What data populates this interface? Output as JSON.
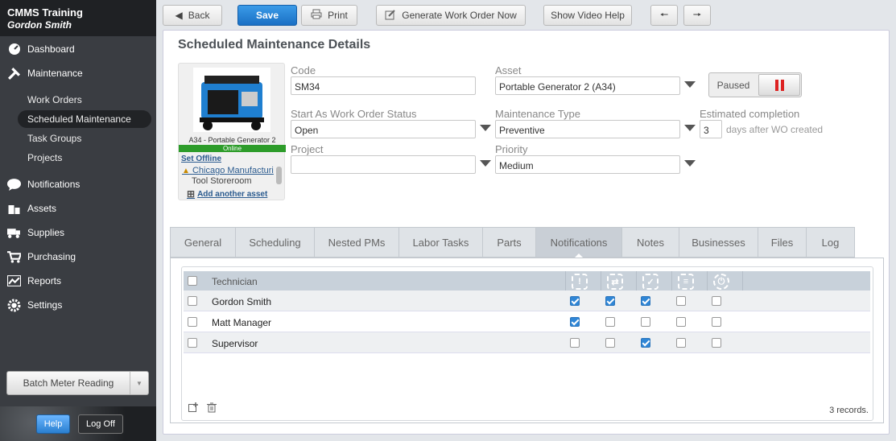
{
  "app": {
    "name": "CMMS Training",
    "user": "Gordon Smith"
  },
  "sidebar": {
    "items": [
      {
        "label": "Dashboard",
        "icon": "dashboard-icon"
      },
      {
        "label": "Maintenance",
        "icon": "tools-icon"
      },
      {
        "label": "Notifications",
        "icon": "chat-bubble-icon"
      },
      {
        "label": "Assets",
        "icon": "boxes-icon"
      },
      {
        "label": "Supplies",
        "icon": "truck-icon"
      },
      {
        "label": "Purchasing",
        "icon": "cart-icon"
      },
      {
        "label": "Reports",
        "icon": "chart-icon"
      },
      {
        "label": "Settings",
        "icon": "gear-icon"
      }
    ],
    "subitems": [
      "Work Orders",
      "Scheduled Maintenance",
      "Task Groups",
      "Projects"
    ],
    "batch_label": "Batch Meter Reading",
    "help": "Help",
    "logoff": "Log Off"
  },
  "toolbar": {
    "back": "Back",
    "save": "Save",
    "print": "Print",
    "generate": "Generate Work Order Now",
    "video": "Show Video Help"
  },
  "page": {
    "title": "Scheduled Maintenance Details"
  },
  "asset_card": {
    "caption": "A34 - Portable Generator 2",
    "status": "Online",
    "set_offline": "Set Offline",
    "location": "Chicago Manufacturi",
    "sublocation": "Tool Storeroom",
    "add_asset": "Add another asset"
  },
  "form": {
    "code_label": "Code",
    "code": "SM34",
    "asset_label": "Asset",
    "asset": "Portable Generator 2 (A34)",
    "paused": "Paused",
    "wo_status_label": "Start As Work Order Status",
    "wo_status": "Open",
    "mtype_label": "Maintenance Type",
    "mtype": "Preventive",
    "est_label": "Estimated completion",
    "est_value": "3",
    "est_suffix": "days after WO created",
    "project_label": "Project",
    "project": "",
    "priority_label": "Priority",
    "priority": "Medium"
  },
  "tabs": [
    "General",
    "Scheduling",
    "Nested PMs",
    "Labor Tasks",
    "Parts",
    "Notifications",
    "Notes",
    "Businesses",
    "Files",
    "Log"
  ],
  "active_tab": "Notifications",
  "notifications": {
    "column": "Technician",
    "icons": [
      "alert-icon",
      "status-change-icon",
      "completed-icon",
      "task-list-icon",
      "power-icon"
    ],
    "rows": [
      {
        "name": "Gordon Smith",
        "checks": [
          true,
          true,
          true,
          false,
          false
        ]
      },
      {
        "name": "Matt Manager",
        "checks": [
          true,
          false,
          false,
          false,
          false
        ]
      },
      {
        "name": "Supervisor",
        "checks": [
          false,
          false,
          true,
          false,
          false
        ]
      }
    ],
    "records": "3 records."
  }
}
